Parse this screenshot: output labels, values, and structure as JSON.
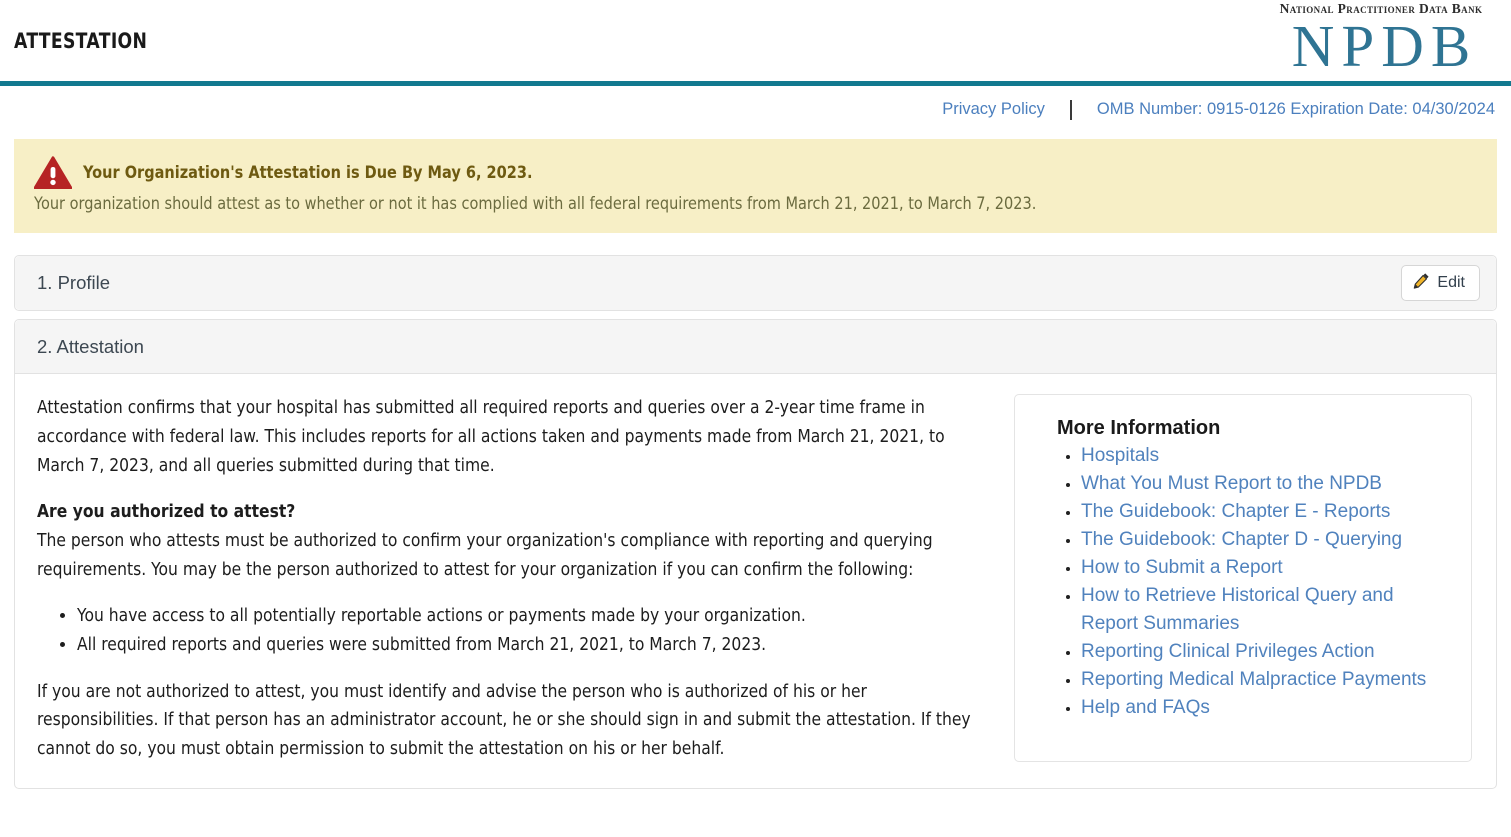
{
  "header": {
    "page_title": "ATTESTATION",
    "logo": {
      "tagline": "National Practitioner Data Bank",
      "mark": "NPDB"
    }
  },
  "subbar": {
    "privacy_policy": "Privacy Policy",
    "omb": "OMB Number: 0915-0126 Expiration Date: 04/30/2024"
  },
  "alert": {
    "icon": "warning-triangle-icon",
    "title": "Your Organization's Attestation is Due By May 6, 2023.",
    "body": "Your organization should attest as to whether or not it has complied with all federal requirements from March 21, 2021, to March 7, 2023."
  },
  "sections": {
    "profile": {
      "title": "1. Profile",
      "edit_label": "Edit"
    },
    "attestation": {
      "title": "2. Attestation",
      "paragraph_1": "Attestation confirms that your hospital has submitted all required reports and queries over a 2-year time frame in accordance with federal law. This includes reports for all actions taken and payments made from March 21, 2021, to March 7, 2023, and all queries submitted during that time.",
      "question_heading": "Are you authorized to attest?",
      "paragraph_2": "The person who attests must be authorized to confirm your organization's compliance with reporting and querying requirements. You may be the person authorized to attest for your organization if you can confirm the following:",
      "bullets": [
        "You have access to all potentially reportable actions or payments made by your organization.",
        "All required reports and queries were submitted from March 21, 2021, to March 7, 2023."
      ],
      "paragraph_3": "If you are not authorized to attest, you must identify and advise the person who is authorized of his or her responsibilities. If that person has an administrator account, he or she should sign in and submit the attestation. If they cannot do so, you must obtain permission to submit the attestation on his or her behalf."
    }
  },
  "more_information": {
    "title": "More Information",
    "links": [
      "Hospitals",
      "What You Must Report to the NPDB",
      "The Guidebook: Chapter E - Reports",
      "The Guidebook: Chapter D - Querying",
      "How to Submit a Report",
      "How to Retrieve Historical Query and Report Summaries",
      "Reporting Clinical Privileges Action",
      "Reporting Medical Malpractice Payments",
      "Help and FAQs"
    ]
  },
  "colors": {
    "header_rule_teal": "#12798f",
    "logo_teal": "#2f7493",
    "link_blue": "#4b7fbe",
    "alert_background": "#f7efc6",
    "alert_title": "#6e5a11",
    "warning_red": "#b62424",
    "panel_head_gray": "#f5f5f5"
  }
}
